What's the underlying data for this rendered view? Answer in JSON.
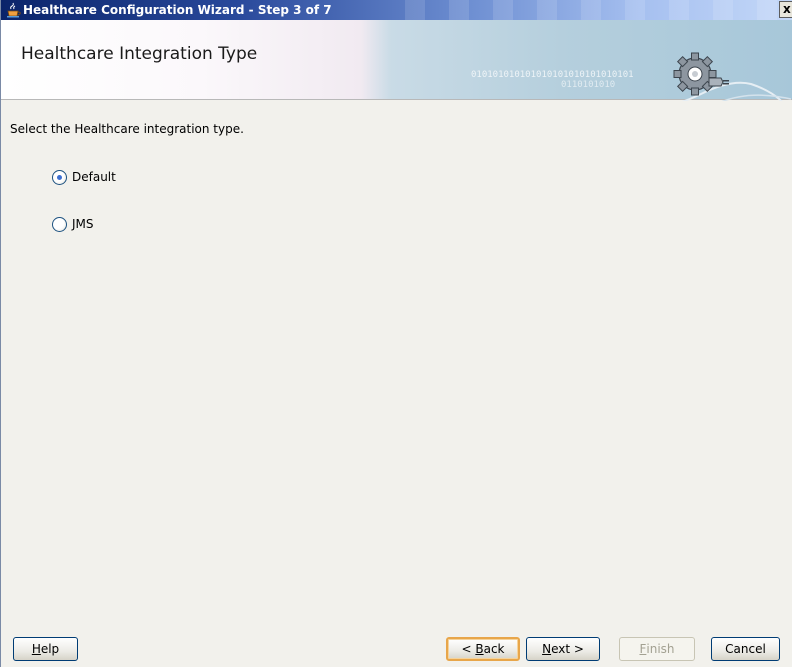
{
  "window": {
    "title": "Healthcare Configuration Wizard - Step 3 of 7",
    "close_label": "x"
  },
  "banner": {
    "title": "Healthcare Integration Type",
    "binary_line1": "010101010101010101010101010101",
    "binary_line2": "0110101010"
  },
  "content": {
    "instruction": "Select the Healthcare integration type.",
    "options": [
      {
        "label": "Default",
        "selected": true
      },
      {
        "label": "JMS",
        "selected": false
      }
    ]
  },
  "buttons": {
    "help": {
      "prefix": "",
      "mnemonic": "H",
      "suffix": "elp"
    },
    "back": {
      "prefix": "< ",
      "mnemonic": "B",
      "suffix": "ack"
    },
    "next": {
      "prefix": "",
      "mnemonic": "N",
      "suffix": "ext >"
    },
    "finish": {
      "prefix": "",
      "mnemonic": "F",
      "suffix": "inish",
      "enabled": false
    },
    "cancel": {
      "label": "Cancel"
    }
  },
  "colors": {
    "titlebar_start": "#0a246a",
    "radio_selected": "#3d6fd1",
    "default_button_border": "#e8a64a"
  }
}
